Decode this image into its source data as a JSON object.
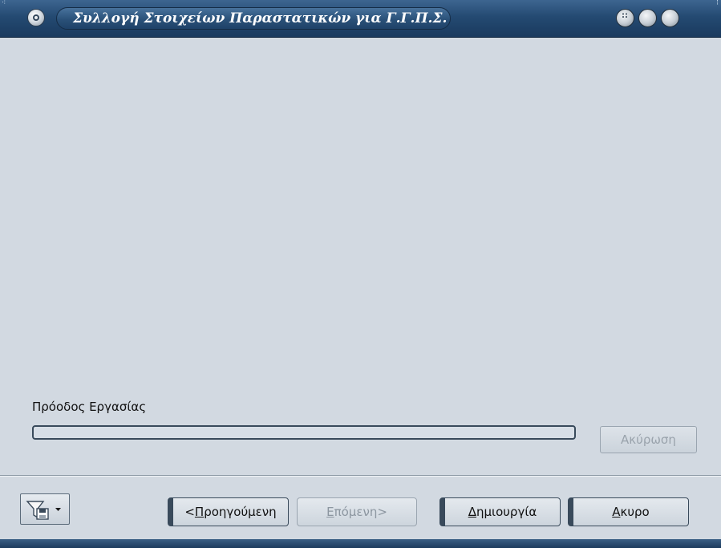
{
  "window": {
    "title": "Συλλογή Στοιχείων Παραστατικών για Γ.Γ.Π.Σ."
  },
  "progress": {
    "label": "Πρόοδος Εργασίας",
    "value_percent": 0,
    "abort_label": "Ακύρωση"
  },
  "footer": {
    "filter_icon": "filter-save-icon",
    "buttons": {
      "prev": {
        "prefix": "< ",
        "mnemonic": "Π",
        "rest": "ροηγούμενη"
      },
      "next": {
        "mnemonic": "Ε",
        "rest": "πόμενη",
        "suffix": " >"
      },
      "create": {
        "mnemonic": "Δ",
        "rest": "ημιουργία"
      },
      "cancel": {
        "mnemonic": "Α",
        "rest": "κυρο"
      }
    }
  },
  "colors": {
    "titlebar": "#244a72",
    "client_bg": "#d2d9e1",
    "button_border": "#394a5b"
  }
}
